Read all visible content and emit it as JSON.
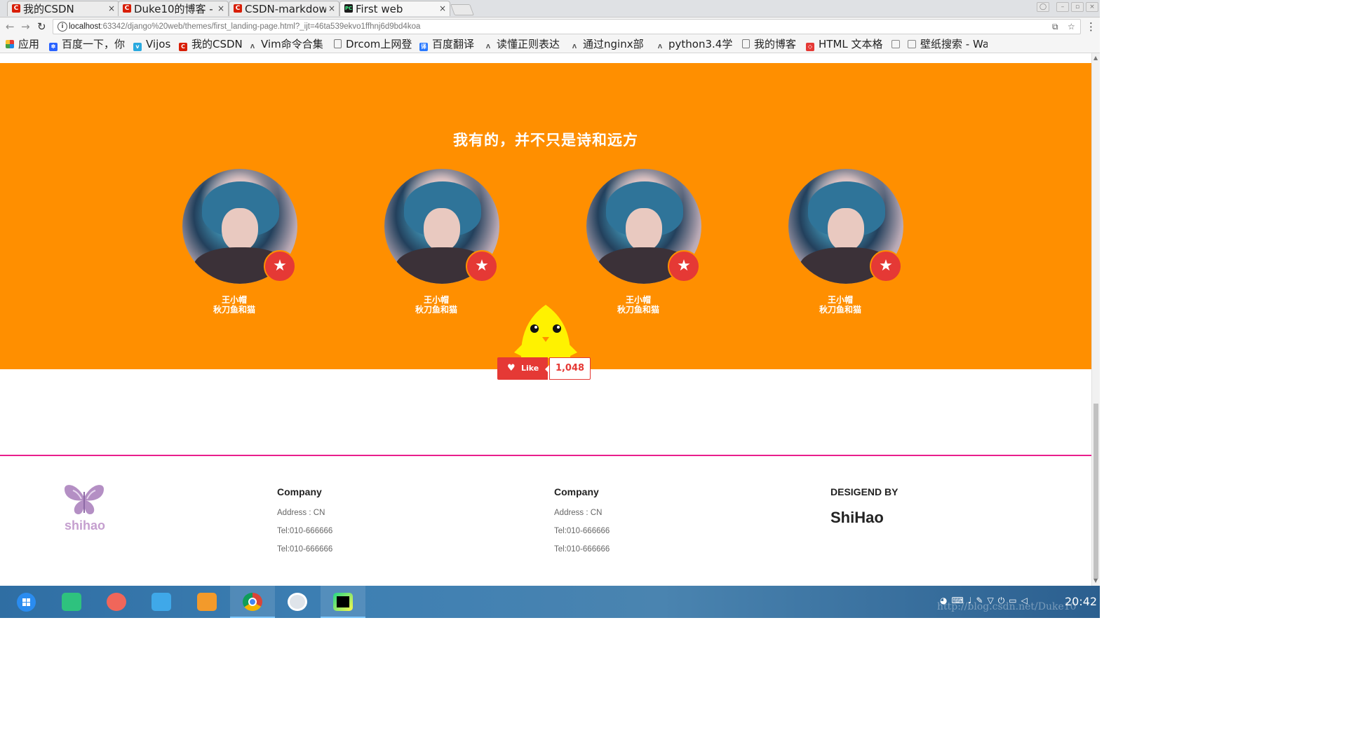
{
  "browser": {
    "tabs": [
      {
        "title": "我的CSDN",
        "icon": "csdn-icon",
        "close": "×"
      },
      {
        "title": "Duke10的博客 -",
        "icon": "csdn-icon",
        "close": "×"
      },
      {
        "title": "CSDN-markdow",
        "icon": "csdn-icon",
        "close": "×"
      },
      {
        "title": "First web",
        "icon": "pycharm-icon",
        "close": "×",
        "active": true
      }
    ],
    "address": {
      "host": "localhost",
      "rest": ":63342/django%20web/themes/first_landing-page.html?_ijt=46ta539ekvo1ffhnj6d9bd4koa"
    },
    "bookmarks": [
      {
        "label": "应用",
        "icon": "apps-grid-icon"
      },
      {
        "label": "百度一下，你",
        "icon": "baidu-icon"
      },
      {
        "label": "Vijos",
        "icon": "vijos-icon"
      },
      {
        "label": "我的CSDN",
        "icon": "csdn-icon"
      },
      {
        "label": "Vim命令合集",
        "icon": "vim-icon"
      },
      {
        "label": "Drcom上网登",
        "icon": "page-icon"
      },
      {
        "label": "百度翻译",
        "icon": "translate-icon"
      },
      {
        "label": "读懂正则表达",
        "icon": "regex-icon"
      },
      {
        "label": "通过nginx部",
        "icon": "nginx-icon"
      },
      {
        "label": "python3.4学",
        "icon": "python-icon"
      },
      {
        "label": "我的博客",
        "icon": "page-icon"
      },
      {
        "label": "HTML 文本格",
        "icon": "html-icon"
      },
      {
        "label": "",
        "icon": "doc-icon"
      },
      {
        "label": "壁纸搜索 - Wa",
        "icon": "wallpaper-icon"
      }
    ]
  },
  "page": {
    "section_title": "我有的，并不只是诗和远方",
    "members": [
      {
        "name": "王小帽",
        "subtitle": "秋刀鱼和猫"
      },
      {
        "name": "王小帽",
        "subtitle": "秋刀鱼和猫"
      },
      {
        "name": "王小帽",
        "subtitle": "秋刀鱼和猫"
      },
      {
        "name": "王小帽",
        "subtitle": "秋刀鱼和猫"
      }
    ],
    "like": {
      "label": "Like",
      "count": "1,048"
    },
    "footer": {
      "logo_text": "shihao",
      "columns": [
        {
          "title": "Company",
          "lines": [
            "Address : CN",
            "Tel:010-666666",
            "Tel:010-666666"
          ]
        },
        {
          "title": "Company",
          "lines": [
            "Address : CN",
            "Tel:010-666666",
            "Tel:010-666666"
          ]
        }
      ],
      "designed_label": "DESIGEND BY",
      "designer": "ShiHao"
    }
  },
  "taskbar": {
    "clock": "20:42",
    "watermark": "http://blog.csdn.net/Duke10",
    "apps": [
      "launcher-icon",
      "terminal-icon",
      "screen-recorder-icon",
      "file-manager-icon",
      "store-icon",
      "chrome-icon",
      "settings-icon",
      "pycharm-icon"
    ]
  },
  "colors": {
    "orange": "#ff8f00",
    "accent_red": "#e53935",
    "footer_line": "#e91e8c"
  }
}
